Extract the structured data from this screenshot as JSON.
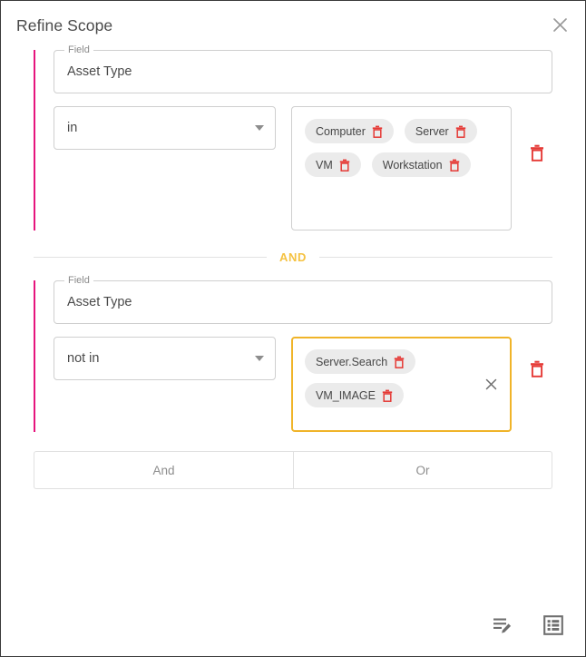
{
  "dialog": {
    "title": "Refine Scope",
    "close_icon": "close-icon"
  },
  "colors": {
    "accent_bar": "#e6157d",
    "and_label": "#f5c242",
    "focus_border": "#f0b429",
    "delete_icon": "#e53935",
    "chip_bg": "#ebebeb"
  },
  "conditions": [
    {
      "field_legend": "Field",
      "field_value": "Asset Type",
      "operator": "in",
      "values": [
        "Computer",
        "Server",
        "VM",
        "Workstation"
      ],
      "focused": false,
      "delete_icon": "trash-icon"
    },
    {
      "field_legend": "Field",
      "field_value": "Asset Type",
      "operator": "not in",
      "values": [
        "Server.Search",
        "VM_IMAGE"
      ],
      "focused": true,
      "clear_icon": "clear-icon",
      "delete_icon": "trash-icon"
    }
  ],
  "joiner": {
    "label": "AND"
  },
  "add_row": {
    "and_label": "And",
    "or_label": "Or"
  },
  "footer": {
    "edit_query_icon": "edit-list-icon",
    "list_view_icon": "list-view-icon"
  }
}
